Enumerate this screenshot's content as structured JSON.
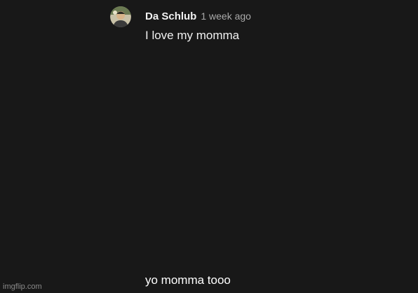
{
  "comment": {
    "author": "Da Schlub",
    "timestamp": "1 week ago",
    "text": "I love my momma",
    "avatar_icon": "user-avatar"
  },
  "caption": "yo momma tooo",
  "watermark": "imgflip.com",
  "colors": {
    "background": "#181818",
    "primary_text": "#f1f1f1",
    "secondary_text": "#aaaaaa"
  }
}
